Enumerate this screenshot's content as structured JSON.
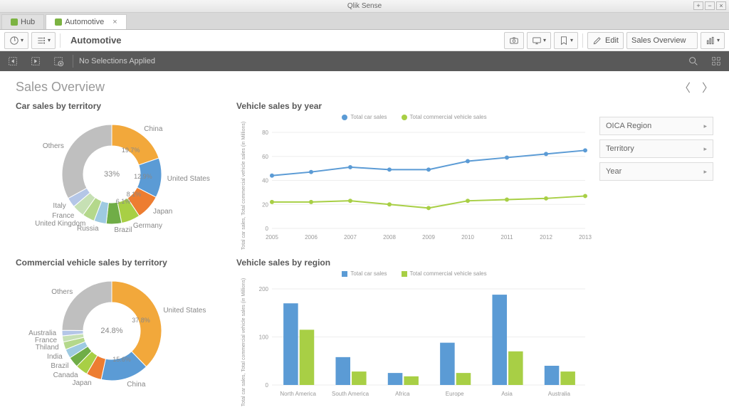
{
  "window": {
    "title": "Qlik Sense"
  },
  "tabs": [
    {
      "label": "Hub",
      "active": false
    },
    {
      "label": "Automotive",
      "active": true
    }
  ],
  "toolbar": {
    "app_title": "Automotive",
    "edit_label": "Edit",
    "sheet_name": "Sales Overview"
  },
  "selection_bar": {
    "text": "No Selections Applied"
  },
  "sheet": {
    "title": "Sales Overview"
  },
  "filters": [
    {
      "label": "OICA Region"
    },
    {
      "label": "Territory"
    },
    {
      "label": "Year"
    }
  ],
  "chart1": {
    "title": "Car sales by territory",
    "center_label": "33%",
    "labels": [
      "China",
      "United States",
      "Japan",
      "Germany",
      "Brazil",
      "Russia",
      "United Kingdom",
      "France",
      "Italy",
      "Others"
    ],
    "pct_labels": [
      "19.7%",
      "12.9%",
      "8.1%",
      "6.1%"
    ]
  },
  "chart2": {
    "title": "Vehicle sales by year",
    "legend": [
      "Total car sales",
      "Total commercial vehicle sales"
    ],
    "ylabel": "Total car sales, Total commercial vehicle sales (in Millions)"
  },
  "chart3": {
    "title": "Commercial vehicle sales by territory",
    "center_label": "24.8%",
    "labels": [
      "United States",
      "China",
      "Japan",
      "Canada",
      "Brazil",
      "India",
      "Thiland",
      "France",
      "Australia",
      "Others"
    ],
    "pct_labels": [
      "37.8%",
      "15.6%"
    ]
  },
  "chart4": {
    "title": "Vehicle sales by region",
    "legend": [
      "Total car sales",
      "Total commercial vehicle sales"
    ],
    "ylabel": "Total car sales, Total commercial vehicle sales (in Millions)"
  },
  "chart_data": [
    {
      "type": "pie",
      "title": "Car sales by territory",
      "series": [
        {
          "name": "China",
          "value": 19.7
        },
        {
          "name": "United States",
          "value": 12.9
        },
        {
          "name": "Japan",
          "value": 8.1
        },
        {
          "name": "Germany",
          "value": 6.1
        },
        {
          "name": "Brazil",
          "value": 5.0
        },
        {
          "name": "Russia",
          "value": 4.0
        },
        {
          "name": "United Kingdom",
          "value": 4.0
        },
        {
          "name": "France",
          "value": 4.0
        },
        {
          "name": "Italy",
          "value": 3.2
        },
        {
          "name": "Others",
          "value": 33.0
        }
      ]
    },
    {
      "type": "line",
      "title": "Vehicle sales by year",
      "xlabel": "",
      "ylabel": "Total car sales, Total commercial vehicle sales (in Millions)",
      "ylim": [
        0,
        80
      ],
      "x": [
        2005,
        2006,
        2007,
        2008,
        2009,
        2010,
        2011,
        2012,
        2013
      ],
      "series": [
        {
          "name": "Total car sales",
          "values": [
            44,
            47,
            51,
            49,
            49,
            56,
            59,
            62,
            65
          ]
        },
        {
          "name": "Total commercial vehicle sales",
          "values": [
            22,
            22,
            23,
            20,
            17,
            23,
            24,
            25,
            27
          ]
        }
      ]
    },
    {
      "type": "pie",
      "title": "Commercial vehicle sales by territory",
      "series": [
        {
          "name": "United States",
          "value": 37.8
        },
        {
          "name": "China",
          "value": 15.6
        },
        {
          "name": "Japan",
          "value": 5.0
        },
        {
          "name": "Canada",
          "value": 4.0
        },
        {
          "name": "Brazil",
          "value": 3.5
        },
        {
          "name": "India",
          "value": 3.0
        },
        {
          "name": "Thiland",
          "value": 2.5
        },
        {
          "name": "France",
          "value": 2.0
        },
        {
          "name": "Australia",
          "value": 1.8
        },
        {
          "name": "Others",
          "value": 24.8
        }
      ]
    },
    {
      "type": "bar",
      "title": "Vehicle sales by region",
      "xlabel": "",
      "ylabel": "Total car sales, Total commercial vehicle sales (in Millions)",
      "ylim": [
        0,
        200
      ],
      "categories": [
        "North America",
        "South America",
        "Africa",
        "Europe",
        "Asia",
        "Australia"
      ],
      "series": [
        {
          "name": "Total car sales",
          "values": [
            170,
            58,
            25,
            88,
            188,
            40
          ]
        },
        {
          "name": "Total commercial vehicle sales",
          "values": [
            115,
            28,
            18,
            25,
            70,
            28
          ]
        }
      ]
    }
  ]
}
